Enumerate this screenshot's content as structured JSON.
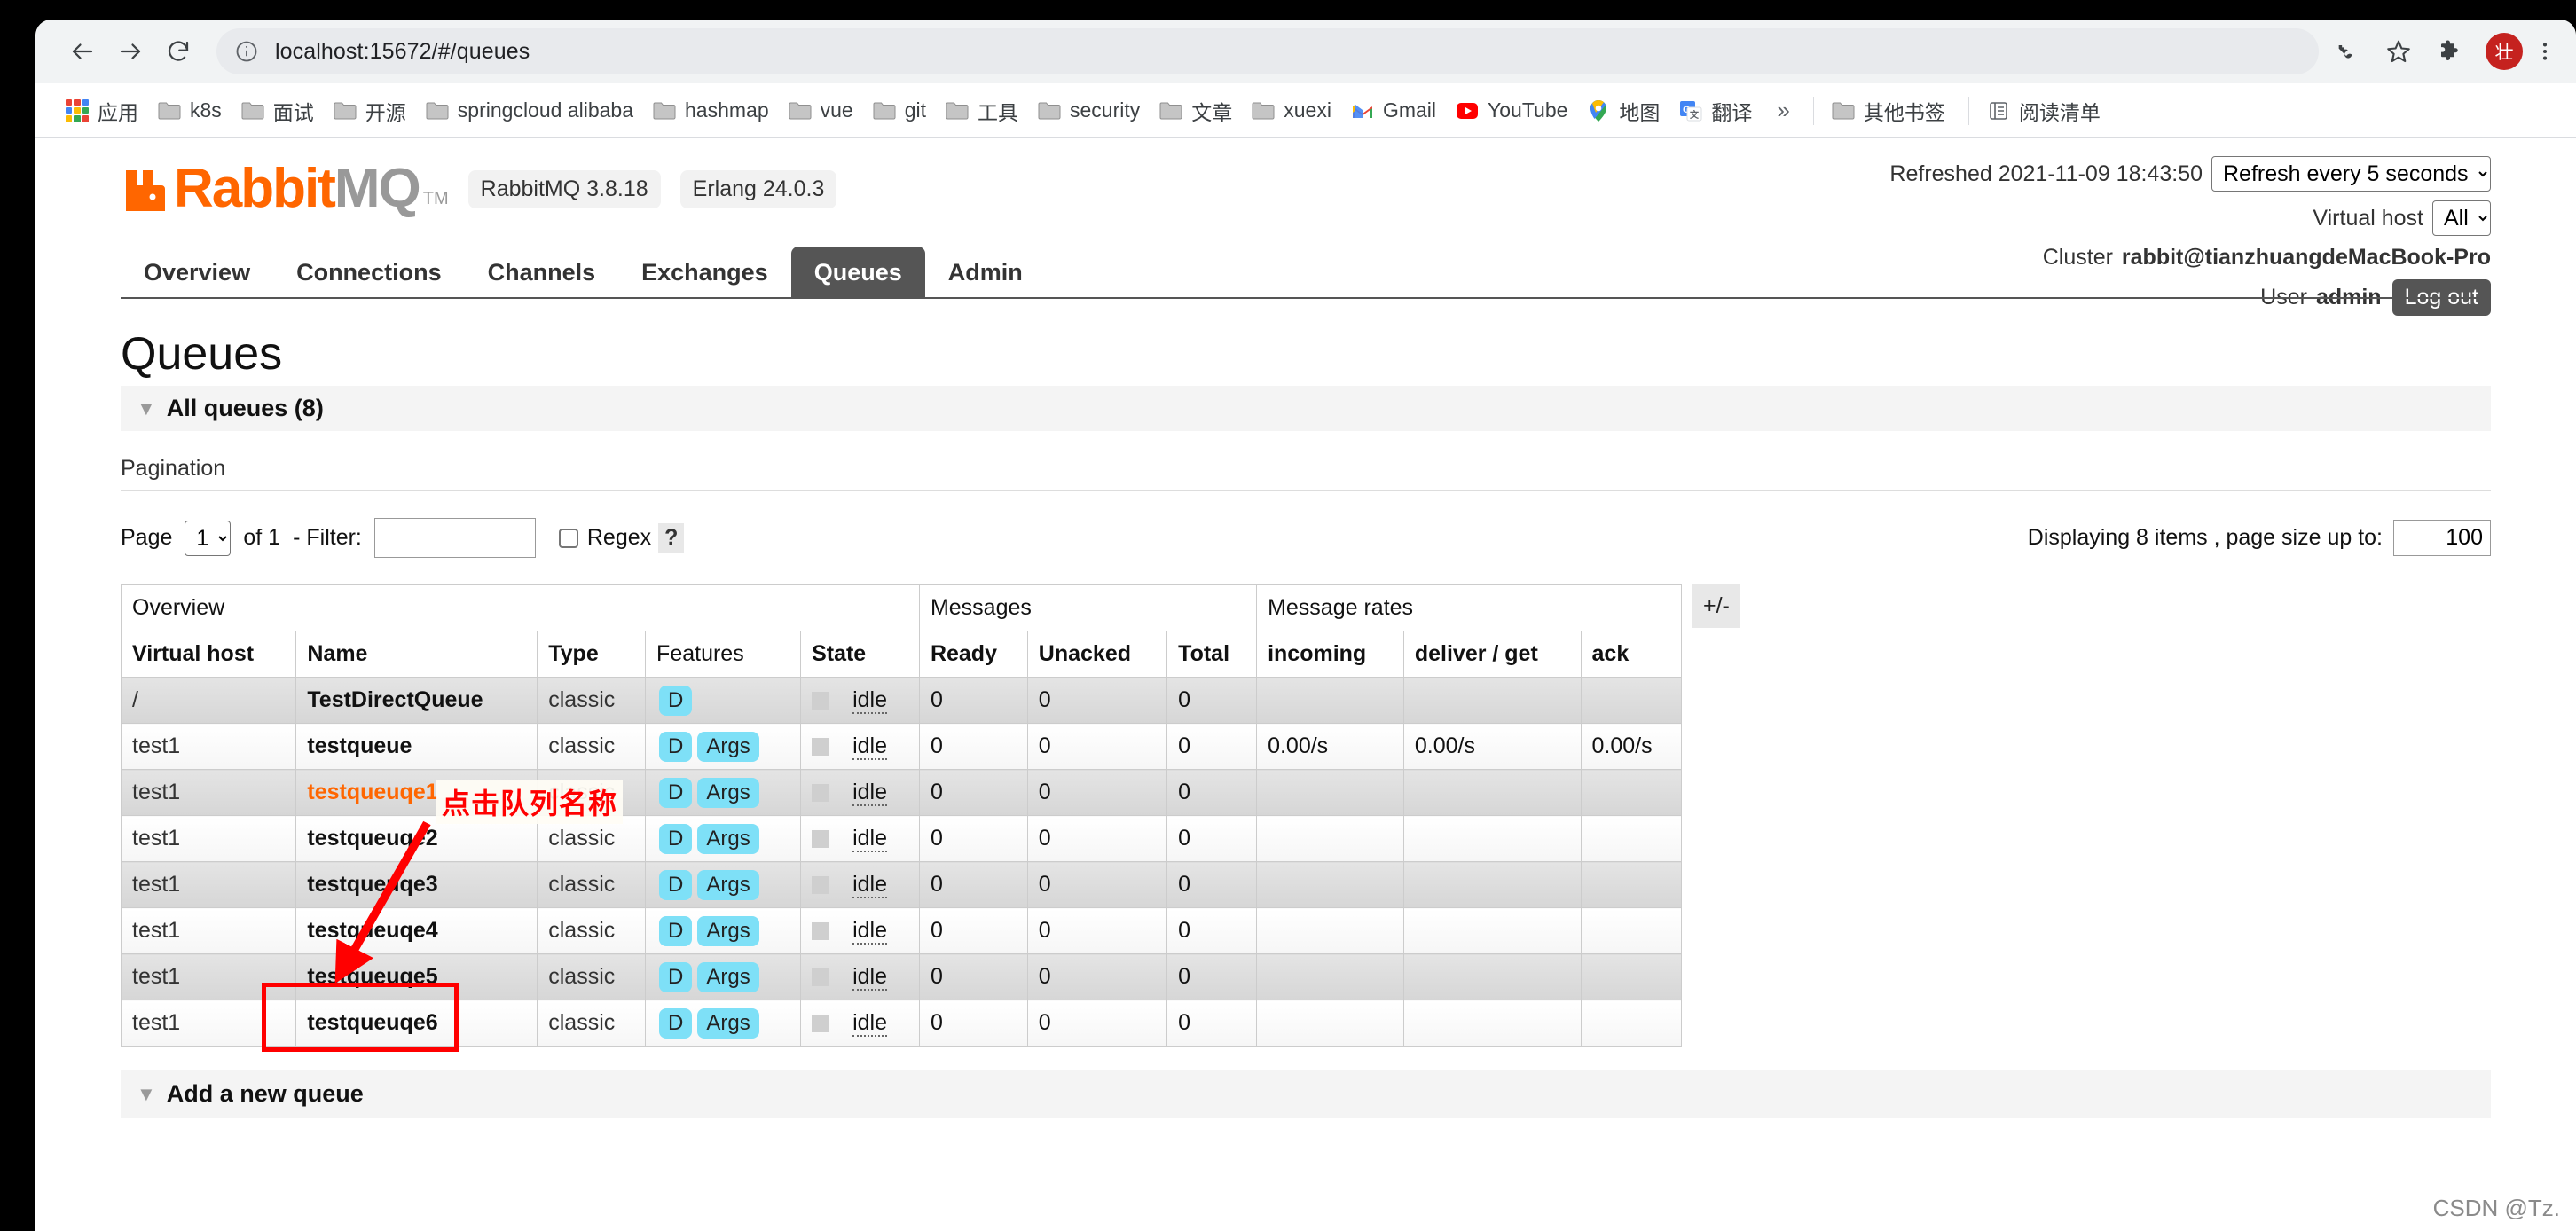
{
  "browser": {
    "url": "localhost:15672/#/queues",
    "nav": {
      "back": "back-arrow",
      "forward": "forward-arrow",
      "reload": "reload"
    },
    "actions": {
      "key": "key-icon",
      "bookmark": "star-icon",
      "extensions": "puzzle-icon",
      "menu": "kebab-menu"
    },
    "avatar_initial": "壮",
    "bookmarks": [
      {
        "label": "应用",
        "icon": "apps-grid-icon"
      },
      {
        "label": "k8s",
        "icon": "folder-icon"
      },
      {
        "label": "面试",
        "icon": "folder-icon"
      },
      {
        "label": "开源",
        "icon": "folder-icon"
      },
      {
        "label": "springcloud alibaba",
        "icon": "folder-icon"
      },
      {
        "label": "hashmap",
        "icon": "folder-icon"
      },
      {
        "label": "vue",
        "icon": "folder-icon"
      },
      {
        "label": "git",
        "icon": "folder-icon"
      },
      {
        "label": "工具",
        "icon": "folder-icon"
      },
      {
        "label": "security",
        "icon": "folder-icon"
      },
      {
        "label": "文章",
        "icon": "folder-icon"
      },
      {
        "label": "xuexi",
        "icon": "folder-icon"
      },
      {
        "label": "Gmail",
        "icon": "gmail-icon"
      },
      {
        "label": "YouTube",
        "icon": "youtube-icon"
      },
      {
        "label": "地图",
        "icon": "maps-icon"
      },
      {
        "label": "翻译",
        "icon": "translate-icon"
      }
    ],
    "overflow_label": "»",
    "other_bookmarks": "其他书签",
    "reading_list": "阅读清单"
  },
  "header": {
    "logo_rabbit": "Rabbit",
    "logo_mq": "MQ",
    "logo_tm": "TM",
    "version_pill": "RabbitMQ 3.8.18",
    "erlang_pill": "Erlang 24.0.3",
    "refreshed_label": "Refreshed 2021-11-09 18:43:50",
    "refresh_select": "Refresh every 5 seconds",
    "vhost_label": "Virtual host",
    "vhost_select": "All",
    "cluster_label": "Cluster",
    "cluster_name": "rabbit@tianzhuangdeMacBook-Pro",
    "user_label": "User",
    "user_name": "admin",
    "logout_label": "Log out"
  },
  "tabs": [
    {
      "label": "Overview",
      "active": false
    },
    {
      "label": "Connections",
      "active": false
    },
    {
      "label": "Channels",
      "active": false
    },
    {
      "label": "Exchanges",
      "active": false
    },
    {
      "label": "Queues",
      "active": true
    },
    {
      "label": "Admin",
      "active": false
    }
  ],
  "page": {
    "title": "Queues",
    "all_queues_label": "All queues (8)",
    "pagination_label": "Pagination",
    "page_word": "Page",
    "page_value": "1",
    "of_label": "of 1",
    "filter_label": "- Filter:",
    "filter_value": "",
    "filter_placeholder": "",
    "regex_label": "Regex",
    "help_label": "?",
    "displaying_label": "Displaying 8 items , page size up to:",
    "page_size_value": "100",
    "plus_minus": "+/-",
    "add_queue_label": "Add a new queue"
  },
  "table": {
    "group_headers": [
      {
        "label": "Overview",
        "span": 5
      },
      {
        "label": "Messages",
        "span": 3
      },
      {
        "label": "Message rates",
        "span": 3
      }
    ],
    "columns": [
      {
        "label": "Virtual host",
        "align": "left"
      },
      {
        "label": "Name",
        "align": "left"
      },
      {
        "label": "Type",
        "align": "left"
      },
      {
        "label": "Features",
        "align": "left"
      },
      {
        "label": "State",
        "align": "left"
      },
      {
        "label": "Ready",
        "align": "right"
      },
      {
        "label": "Unacked",
        "align": "right"
      },
      {
        "label": "Total",
        "align": "right"
      },
      {
        "label": "incoming",
        "align": "left"
      },
      {
        "label": "deliver / get",
        "align": "left"
      },
      {
        "label": "ack",
        "align": "left"
      }
    ],
    "rows": [
      {
        "vhost": "/",
        "name": "TestDirectQueue",
        "highlight": false,
        "type": "classic",
        "features": [
          "D"
        ],
        "state": "idle",
        "ready": "0",
        "unacked": "0",
        "total": "0",
        "incoming": "",
        "deliver": "",
        "ack": ""
      },
      {
        "vhost": "test1",
        "name": "testqueue",
        "highlight": false,
        "type": "classic",
        "features": [
          "D",
          "Args"
        ],
        "state": "idle",
        "ready": "0",
        "unacked": "0",
        "total": "0",
        "incoming": "0.00/s",
        "deliver": "0.00/s",
        "ack": "0.00/s"
      },
      {
        "vhost": "test1",
        "name": "testqueuqe1",
        "highlight": true,
        "type": "classic",
        "features": [
          "D",
          "Args"
        ],
        "state": "idle",
        "ready": "0",
        "unacked": "0",
        "total": "0",
        "incoming": "",
        "deliver": "",
        "ack": ""
      },
      {
        "vhost": "test1",
        "name": "testqueuqe2",
        "highlight": false,
        "type": "classic",
        "features": [
          "D",
          "Args"
        ],
        "state": "idle",
        "ready": "0",
        "unacked": "0",
        "total": "0",
        "incoming": "",
        "deliver": "",
        "ack": ""
      },
      {
        "vhost": "test1",
        "name": "testqueuqe3",
        "highlight": false,
        "type": "classic",
        "features": [
          "D",
          "Args"
        ],
        "state": "idle",
        "ready": "0",
        "unacked": "0",
        "total": "0",
        "incoming": "",
        "deliver": "",
        "ack": ""
      },
      {
        "vhost": "test1",
        "name": "testqueuqe4",
        "highlight": false,
        "type": "classic",
        "features": [
          "D",
          "Args"
        ],
        "state": "idle",
        "ready": "0",
        "unacked": "0",
        "total": "0",
        "incoming": "",
        "deliver": "",
        "ack": ""
      },
      {
        "vhost": "test1",
        "name": "testqueuqe5",
        "highlight": false,
        "type": "classic",
        "features": [
          "D",
          "Args"
        ],
        "state": "idle",
        "ready": "0",
        "unacked": "0",
        "total": "0",
        "incoming": "",
        "deliver": "",
        "ack": ""
      },
      {
        "vhost": "test1",
        "name": "testqueuqe6",
        "highlight": false,
        "type": "classic",
        "features": [
          "D",
          "Args"
        ],
        "state": "idle",
        "ready": "0",
        "unacked": "0",
        "total": "0",
        "incoming": "",
        "deliver": "",
        "ack": ""
      }
    ]
  },
  "annotation": {
    "text": "点击队列名称",
    "color": "#ff0000"
  },
  "watermark": "CSDN @Tz.",
  "colors": {
    "brand_orange": "#ff6600",
    "tab_active_bg": "#555555",
    "badge_cyan": "#7ee0f7",
    "annotation_red": "#ff0000",
    "avatar_red": "#c5221f"
  }
}
